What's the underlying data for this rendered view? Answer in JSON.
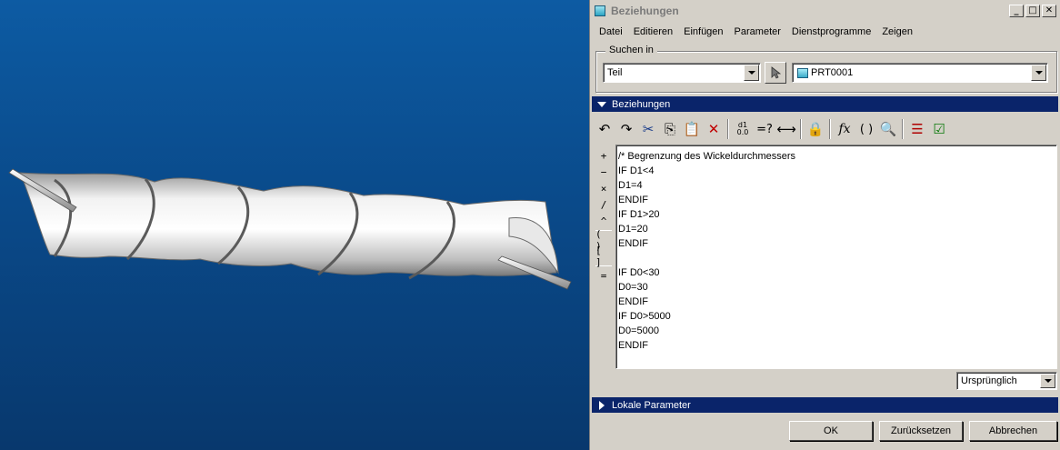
{
  "window": {
    "title": "Beziehungen",
    "buttons": {
      "minimize": "_",
      "maximize": "□",
      "close": "✕"
    }
  },
  "menu": [
    "Datei",
    "Editieren",
    "Einfügen",
    "Parameter",
    "Dienstprogramme",
    "Zeigen"
  ],
  "search": {
    "legend": "Suchen in",
    "scope_value": "Teil",
    "model_value": "PRT0001"
  },
  "relations_section": {
    "label": "Beziehungen"
  },
  "toolbar": {
    "undo": "undo-icon",
    "redo": "redo-icon",
    "cut": "scissors-icon",
    "copy": "copy-icon",
    "paste": "paste-icon",
    "delete": "delete-icon",
    "units": "units-icon",
    "evaluate": "=?",
    "measure": "measure-icon",
    "verify": "lock-icon",
    "function": "fx",
    "brackets": "( )",
    "parameter": "parameter-icon",
    "sort": "sort-icon",
    "check": "check-icon"
  },
  "operators": [
    "+",
    "−",
    "×",
    "/",
    "^",
    "( )",
    "[ ]",
    "="
  ],
  "editor_lines": [
    "/* Begrenzung des Wickeldurchmessers",
    "IF D1<4",
    "D1=4",
    "ENDIF",
    "IF D1>20",
    "D1=20",
    "ENDIF",
    "",
    "IF D0<30",
    "D0=30",
    "ENDIF",
    "IF D0>5000",
    "D0=5000",
    "ENDIF"
  ],
  "display_mode": "Ursprünglich",
  "local_params_section": {
    "label": "Lokale Parameter"
  },
  "footer": {
    "ok": "OK",
    "reset": "Zurücksetzen",
    "cancel": "Abbrechen"
  },
  "colors": {
    "viewport_top": "#0d5ba3",
    "viewport_bottom": "#08386d",
    "header_bg": "#0a246a",
    "dialog_bg": "#d4d0c8"
  }
}
